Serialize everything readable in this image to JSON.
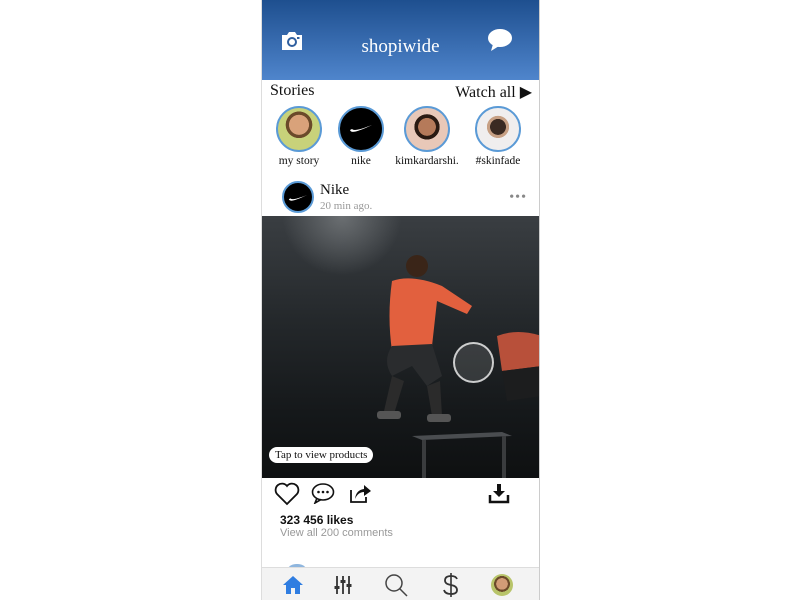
{
  "header": {
    "title": "shopiwide",
    "left_icon": "camera-icon",
    "right_icon": "chat-bubble-icon",
    "gradient_top": "#1e4f8f",
    "gradient_bottom": "#4f85cc"
  },
  "stories": {
    "label": "Stories",
    "watch_all": "Watch all ▶",
    "items": [
      {
        "name": "my story",
        "avatar": "user-photo"
      },
      {
        "name": "nike",
        "avatar": "nike-logo"
      },
      {
        "name": "kimkardarshi.",
        "avatar": "user-photo"
      },
      {
        "name": "#skinfade",
        "avatar": "user-photo"
      }
    ],
    "ring_color": "#5a9ad6"
  },
  "post": {
    "author": "Nike",
    "time": "20 min ago.",
    "more": "•••",
    "tap_label": "Tap to view products",
    "likes": "323 456 likes",
    "comments": "View all 200 comments"
  },
  "actions": [
    "heart-icon",
    "comment-icon",
    "share-icon",
    "download-icon"
  ],
  "tabbar": {
    "items": [
      "home-icon",
      "filters-icon",
      "search-icon",
      "dollar-icon",
      "profile-avatar"
    ],
    "active": "home-icon",
    "active_color": "#2f7de1"
  }
}
